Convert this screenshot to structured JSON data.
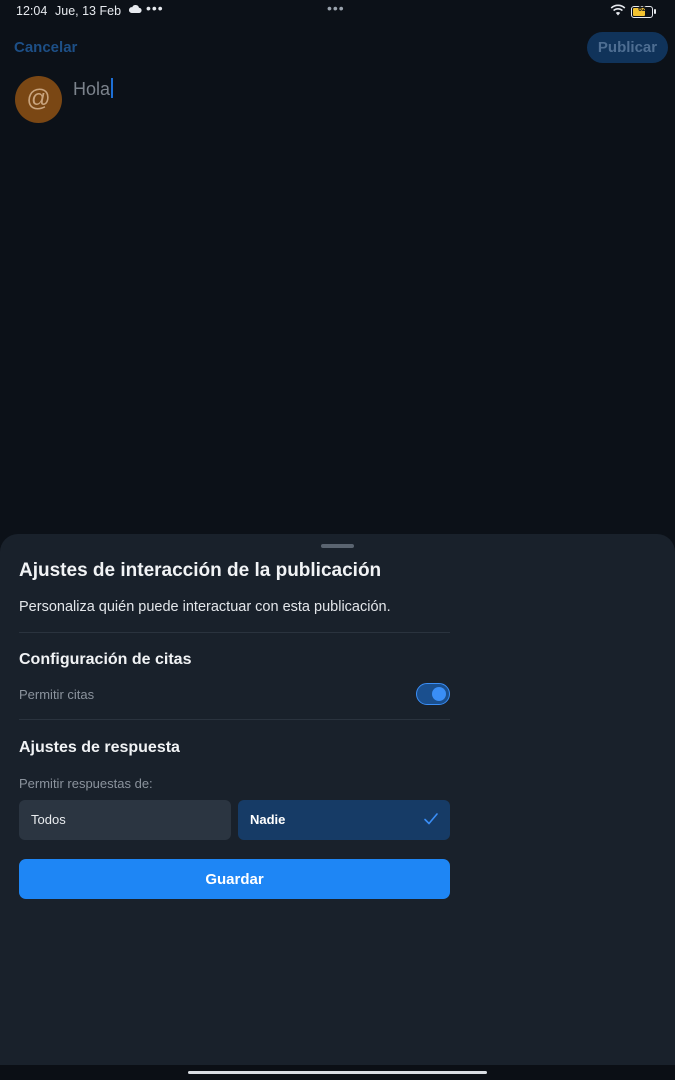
{
  "status_bar": {
    "time": "12:04",
    "date": "Jue, 13 Feb",
    "more_dots": "•••",
    "center_dots": "•••",
    "weather_icon": "cloud-icon",
    "wifi_icon": "wifi-icon",
    "battery_level": "62",
    "battery_color": "#f2c230"
  },
  "composer": {
    "cancel_label": "Cancelar",
    "publish_label": "Publicar",
    "avatar_glyph": "@",
    "avatar_color": "#7a4714",
    "text_value": "Hola"
  },
  "sheet": {
    "title": "Ajustes de interacción de la publicación",
    "description": "Personaliza quién puede interactuar con esta publicación.",
    "quotes_section": {
      "title": "Configuración de citas",
      "allow_quotes_label": "Permitir citas",
      "allow_quotes_enabled": true
    },
    "reply_section": {
      "title": "Ajustes de respuesta",
      "allow_replies_label": "Permitir respuestas de:",
      "options": [
        {
          "label": "Todos",
          "selected": false
        },
        {
          "label": "Nadie",
          "selected": true
        }
      ]
    },
    "save_label": "Guardar",
    "accent_color": "#1e86f5"
  }
}
